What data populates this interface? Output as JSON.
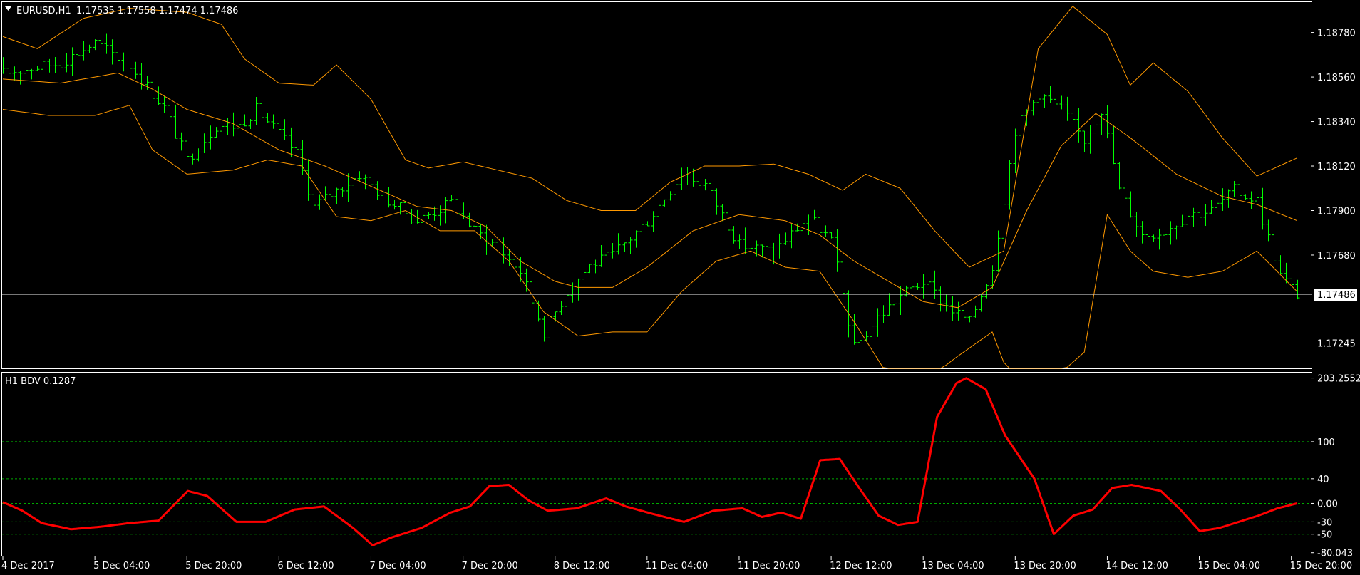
{
  "window": {
    "symbol_label": "EURUSD,H1",
    "ohlc": "1.17535 1.17558 1.17474 1.17486",
    "indicator_label": "H1 BDV 0.1287"
  },
  "colors": {
    "background": "#000000",
    "frame": "#ffffff",
    "candles": "#00ff00",
    "bands": "#ff9900",
    "indicator": "#ff0000",
    "levels": "#00aa00",
    "price_line": "#c0c0c0"
  },
  "chart_data": [
    {
      "type": "bar",
      "title": "EURUSD,H1",
      "ylim": [
        1.1712,
        1.1893
      ],
      "y_ticks": [
        "1.18780",
        "1.18560",
        "1.18340",
        "1.18120",
        "1.17900",
        "1.17680",
        "1.17245"
      ],
      "y_tick_values": [
        1.1878,
        1.1856,
        1.1834,
        1.1812,
        1.179,
        1.1768,
        1.17245
      ],
      "current_price": 1.17486,
      "current_price_label": "1.17486",
      "x_ticks": [
        "4 Dec 2017",
        "5 Dec 04:00",
        "5 Dec 20:00",
        "6 Dec 12:00",
        "7 Dec 04:00",
        "7 Dec 20:00",
        "8 Dec 12:00",
        "11 Dec 04:00",
        "11 Dec 20:00",
        "12 Dec 12:00",
        "13 Dec 04:00",
        "13 Dec 20:00",
        "14 Dec 12:00",
        "15 Dec 04:00",
        "15 Dec 20:00"
      ],
      "x_tick_positions": [
        0,
        16,
        32,
        48,
        64,
        80,
        96,
        112,
        128,
        144,
        160,
        176,
        192,
        208,
        224
      ],
      "bar_count": 226,
      "close_anchors": [
        [
          0,
          1.1858
        ],
        [
          10,
          1.1863
        ],
        [
          16,
          1.1873
        ],
        [
          22,
          1.1862
        ],
        [
          28,
          1.1841
        ],
        [
          32,
          1.1815
        ],
        [
          37,
          1.1832
        ],
        [
          41,
          1.1832
        ],
        [
          44,
          1.184
        ],
        [
          48,
          1.1828
        ],
        [
          51,
          1.1818
        ],
        [
          54,
          1.1792
        ],
        [
          58,
          1.18
        ],
        [
          62,
          1.1808
        ],
        [
          66,
          1.1797
        ],
        [
          72,
          1.1785
        ],
        [
          78,
          1.1794
        ],
        [
          82,
          1.178
        ],
        [
          86,
          1.1772
        ],
        [
          90,
          1.176
        ],
        [
          94,
          1.173
        ],
        [
          98,
          1.175
        ],
        [
          102,
          1.1763
        ],
        [
          106,
          1.1768
        ],
        [
          112,
          1.1785
        ],
        [
          118,
          1.1808
        ],
        [
          122,
          1.1803
        ],
        [
          128,
          1.1773
        ],
        [
          134,
          1.177
        ],
        [
          140,
          1.1787
        ],
        [
          144,
          1.1775
        ],
        [
          148,
          1.1722
        ],
        [
          152,
          1.1737
        ],
        [
          156,
          1.1748
        ],
        [
          160,
          1.1755
        ],
        [
          164,
          1.1743
        ],
        [
          168,
          1.1735
        ],
        [
          172,
          1.1762
        ],
        [
          176,
          1.183
        ],
        [
          180,
          1.1848
        ],
        [
          184,
          1.184
        ],
        [
          188,
          1.1825
        ],
        [
          191,
          1.184
        ],
        [
          194,
          1.18
        ],
        [
          198,
          1.1778
        ],
        [
          202,
          1.178
        ],
        [
          206,
          1.1788
        ],
        [
          210,
          1.179
        ],
        [
          214,
          1.18
        ],
        [
          218,
          1.1795
        ],
        [
          222,
          1.1758
        ],
        [
          225,
          1.17486
        ]
      ],
      "bands": {
        "middle": [
          [
            0,
            1.1855
          ],
          [
            10,
            1.1853
          ],
          [
            20,
            1.1858
          ],
          [
            26,
            1.185
          ],
          [
            32,
            1.184
          ],
          [
            40,
            1.1833
          ],
          [
            48,
            1.182
          ],
          [
            56,
            1.1812
          ],
          [
            64,
            1.1802
          ],
          [
            72,
            1.1792
          ],
          [
            78,
            1.179
          ],
          [
            84,
            1.1782
          ],
          [
            90,
            1.1765
          ],
          [
            96,
            1.1755
          ],
          [
            100,
            1.1752
          ],
          [
            106,
            1.1752
          ],
          [
            112,
            1.1762
          ],
          [
            120,
            1.178
          ],
          [
            128,
            1.1788
          ],
          [
            136,
            1.1785
          ],
          [
            142,
            1.1778
          ],
          [
            148,
            1.1765
          ],
          [
            154,
            1.1755
          ],
          [
            160,
            1.1745
          ],
          [
            166,
            1.1742
          ],
          [
            172,
            1.1752
          ],
          [
            178,
            1.179
          ],
          [
            184,
            1.1822
          ],
          [
            190,
            1.1838
          ],
          [
            196,
            1.1826
          ],
          [
            204,
            1.1808
          ],
          [
            212,
            1.1797
          ],
          [
            218,
            1.1793
          ],
          [
            225,
            1.1785
          ]
        ],
        "upper": [
          [
            0,
            1.1876
          ],
          [
            6,
            1.187
          ],
          [
            14,
            1.1885
          ],
          [
            22,
            1.189
          ],
          [
            32,
            1.1888
          ],
          [
            38,
            1.1882
          ],
          [
            42,
            1.1865
          ],
          [
            48,
            1.1853
          ],
          [
            54,
            1.1852
          ],
          [
            58,
            1.1862
          ],
          [
            64,
            1.1845
          ],
          [
            70,
            1.1815
          ],
          [
            74,
            1.1811
          ],
          [
            80,
            1.1814
          ],
          [
            86,
            1.181
          ],
          [
            92,
            1.1806
          ],
          [
            98,
            1.1795
          ],
          [
            104,
            1.179
          ],
          [
            110,
            1.179
          ],
          [
            116,
            1.1804
          ],
          [
            122,
            1.1812
          ],
          [
            128,
            1.1812
          ],
          [
            134,
            1.1813
          ],
          [
            140,
            1.1808
          ],
          [
            146,
            1.18
          ],
          [
            150,
            1.1808
          ],
          [
            156,
            1.1801
          ],
          [
            162,
            1.178
          ],
          [
            168,
            1.1762
          ],
          [
            174,
            1.177
          ],
          [
            180,
            1.187
          ],
          [
            186,
            1.1891
          ],
          [
            192,
            1.1877
          ],
          [
            196,
            1.1852
          ],
          [
            200,
            1.1863
          ],
          [
            206,
            1.1849
          ],
          [
            212,
            1.1826
          ],
          [
            218,
            1.1807
          ],
          [
            225,
            1.1816
          ]
        ],
        "lower": [
          [
            0,
            1.184
          ],
          [
            8,
            1.1837
          ],
          [
            16,
            1.1837
          ],
          [
            22,
            1.1842
          ],
          [
            26,
            1.182
          ],
          [
            32,
            1.1808
          ],
          [
            40,
            1.181
          ],
          [
            46,
            1.1815
          ],
          [
            52,
            1.1812
          ],
          [
            58,
            1.1787
          ],
          [
            64,
            1.1785
          ],
          [
            70,
            1.179
          ],
          [
            76,
            1.178
          ],
          [
            82,
            1.178
          ],
          [
            88,
            1.1765
          ],
          [
            94,
            1.174
          ],
          [
            100,
            1.1728
          ],
          [
            106,
            1.173
          ],
          [
            112,
            1.173
          ],
          [
            118,
            1.175
          ],
          [
            124,
            1.1765
          ],
          [
            130,
            1.177
          ],
          [
            136,
            1.1762
          ],
          [
            142,
            1.176
          ],
          [
            148,
            1.1735
          ],
          [
            154,
            1.1708
          ],
          [
            160,
            1.1705
          ],
          [
            166,
            1.1718
          ],
          [
            172,
            1.173
          ],
          [
            176,
            1.17
          ],
          [
            182,
            1.1705
          ],
          [
            188,
            1.172
          ],
          [
            192,
            1.1788
          ],
          [
            196,
            1.177
          ],
          [
            200,
            1.176
          ],
          [
            206,
            1.1757
          ],
          [
            212,
            1.176
          ],
          [
            218,
            1.177
          ],
          [
            225,
            1.175
          ]
        ]
      }
    },
    {
      "type": "line",
      "title": "H1 BDV 0.1287",
      "ylim": [
        -85,
        212
      ],
      "y_ticks": [
        "203.2552",
        "100",
        "40",
        "0.00",
        "-30",
        "-50",
        "-80.043"
      ],
      "y_tick_values": [
        203.2552,
        100,
        40,
        0,
        -30,
        -50,
        -80.043
      ],
      "levels": [
        100,
        40,
        0,
        -30,
        -50
      ],
      "series": [
        {
          "points": [
            [
              0,
              2
            ],
            [
              4,
              -12
            ],
            [
              8,
              -32
            ],
            [
              14,
              -42
            ],
            [
              20,
              -38
            ],
            [
              26,
              -32
            ],
            [
              32,
              -28
            ],
            [
              38,
              20
            ],
            [
              42,
              12
            ],
            [
              48,
              -30
            ],
            [
              54,
              -30
            ],
            [
              60,
              -10
            ],
            [
              66,
              -5
            ],
            [
              72,
              -40
            ],
            [
              76,
              -68
            ],
            [
              80,
              -55
            ],
            [
              86,
              -40
            ],
            [
              92,
              -15
            ],
            [
              96,
              -5
            ],
            [
              100,
              28
            ],
            [
              104,
              30
            ],
            [
              108,
              5
            ],
            [
              112,
              -12
            ],
            [
              118,
              -8
            ],
            [
              124,
              8
            ],
            [
              128,
              -5
            ],
            [
              134,
              -18
            ],
            [
              140,
              -30
            ],
            [
              146,
              -12
            ],
            [
              152,
              -8
            ],
            [
              156,
              -22
            ],
            [
              160,
              -15
            ],
            [
              164,
              -25
            ],
            [
              168,
              70
            ],
            [
              172,
              72
            ],
            [
              176,
              25
            ],
            [
              180,
              -20
            ],
            [
              184,
              -35
            ],
            [
              188,
              -30
            ],
            [
              192,
              140
            ],
            [
              196,
              195
            ],
            [
              198,
              203
            ],
            [
              202,
              185
            ],
            [
              206,
              110
            ],
            [
              212,
              40
            ],
            [
              216,
              -50
            ],
            [
              220,
              -20
            ],
            [
              224,
              -10
            ],
            [
              228,
              25
            ],
            [
              232,
              30
            ],
            [
              238,
              20
            ],
            [
              242,
              -10
            ],
            [
              246,
              -45
            ],
            [
              250,
              -40
            ],
            [
              254,
              -30
            ],
            [
              258,
              -20
            ],
            [
              262,
              -8
            ],
            [
              266,
              0
            ]
          ]
        }
      ]
    }
  ]
}
